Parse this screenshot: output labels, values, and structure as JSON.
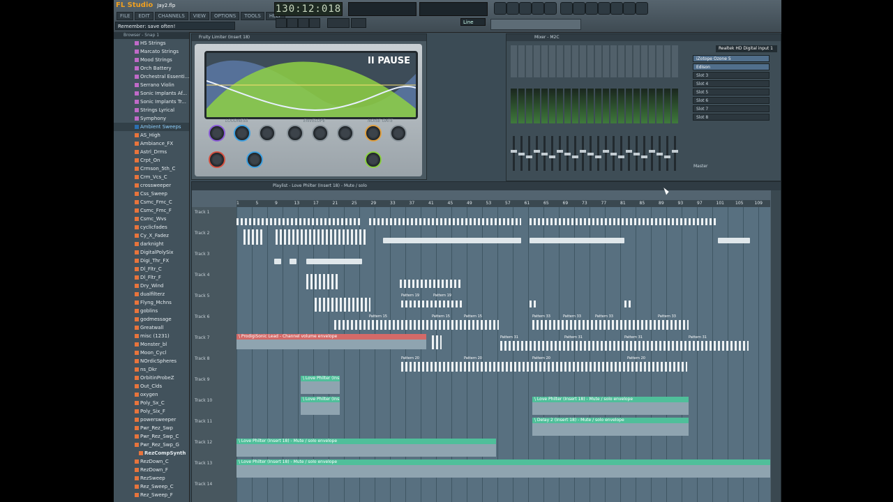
{
  "app": {
    "name": "FL Studio",
    "project": "Jay2.flp",
    "menu": [
      "FILE",
      "EDIT",
      "CHANNELS",
      "VIEW",
      "OPTIONS",
      "TOOLS",
      "HELP"
    ],
    "hint": "Remember: save often!",
    "time": "130:12:018",
    "tempo_label": "Line"
  },
  "browser": {
    "title": "Browser - Snap 1",
    "items": [
      {
        "label": "HS Strings",
        "color": "#c06ac8"
      },
      {
        "label": "Marcato Strings",
        "color": "#c06ac8"
      },
      {
        "label": "Mood Strings",
        "color": "#c06ac8"
      },
      {
        "label": "Orch Battery",
        "color": "#c06ac8"
      },
      {
        "label": "Orchestral Essenti...",
        "color": "#c06ac8"
      },
      {
        "label": "Serrano Violin",
        "color": "#c06ac8"
      },
      {
        "label": "Sonic Implants Af...",
        "color": "#c06ac8"
      },
      {
        "label": "Sonic Implants Tr...",
        "color": "#c06ac8"
      },
      {
        "label": "Strings Lyrical",
        "color": "#c06ac8"
      },
      {
        "label": "Symphony",
        "color": "#c06ac8"
      },
      {
        "label": "Ambient Sweeps",
        "color": "#2b6fb0",
        "selected": true
      },
      {
        "label": "AS_High",
        "color": "#e8743c"
      },
      {
        "label": "Ambiance_FX",
        "color": "#e8743c"
      },
      {
        "label": "Astrl_Drms",
        "color": "#e8743c"
      },
      {
        "label": "Crpt_On",
        "color": "#e8743c"
      },
      {
        "label": "Crmson_5th_C",
        "color": "#e8743c"
      },
      {
        "label": "Crm_Vcs_C",
        "color": "#e8743c"
      },
      {
        "label": "crossweeper",
        "color": "#e8743c"
      },
      {
        "label": "Css_Sweep",
        "color": "#e8743c"
      },
      {
        "label": "Csmc_Fmc_C",
        "color": "#e8743c"
      },
      {
        "label": "Csmc_Fmc_F",
        "color": "#e8743c"
      },
      {
        "label": "Csmc_Wvs",
        "color": "#e8743c"
      },
      {
        "label": "cyclicfades",
        "color": "#e8743c"
      },
      {
        "label": "Cy_X_Fadez",
        "color": "#e8743c"
      },
      {
        "label": "darknight",
        "color": "#e8743c"
      },
      {
        "label": "DigitalPolySix",
        "color": "#e8743c"
      },
      {
        "label": "Digi_Thr_FX",
        "color": "#e8743c"
      },
      {
        "label": "Dl_Fltr_C",
        "color": "#e8743c"
      },
      {
        "label": "Dl_Fltr_F",
        "color": "#e8743c"
      },
      {
        "label": "Dry_Wind",
        "color": "#e8743c"
      },
      {
        "label": "dualfilterz",
        "color": "#e8743c"
      },
      {
        "label": "Flyng_Mchns",
        "color": "#e8743c"
      },
      {
        "label": "goblins",
        "color": "#e8743c"
      },
      {
        "label": "godmessage",
        "color": "#e8743c"
      },
      {
        "label": "Greatwall",
        "color": "#e8743c"
      },
      {
        "label": "misc (1231)",
        "color": "#e8743c"
      },
      {
        "label": "Monster_bl",
        "color": "#e8743c"
      },
      {
        "label": "Moon_Cycl",
        "color": "#e8743c"
      },
      {
        "label": "NOrdicSpheres",
        "color": "#e8743c"
      },
      {
        "label": "ns_Dkr",
        "color": "#e8743c"
      },
      {
        "label": "OrbitinProbeZ",
        "color": "#e8743c"
      },
      {
        "label": "Out_Clds",
        "color": "#e8743c"
      },
      {
        "label": "oxygen",
        "color": "#e8743c"
      },
      {
        "label": "Poly_Sx_C",
        "color": "#e8743c"
      },
      {
        "label": "Poly_Six_F",
        "color": "#e8743c"
      },
      {
        "label": "powersweeper",
        "color": "#e8743c"
      },
      {
        "label": "Pwr_Rez_Swp",
        "color": "#e8743c"
      },
      {
        "label": "Pwr_Rez_Swp_C",
        "color": "#e8743c"
      },
      {
        "label": "Pwr_Rez_Swp_G",
        "color": "#e8743c"
      },
      {
        "label": "RezCompSynth",
        "color": "#e8743c",
        "sub": true
      },
      {
        "label": "RezDown_C",
        "color": "#e8743c"
      },
      {
        "label": "RezDown_F",
        "color": "#e8743c"
      },
      {
        "label": "RezSweep",
        "color": "#e8743c"
      },
      {
        "label": "Rez_Sweep_C",
        "color": "#e8743c"
      },
      {
        "label": "Rez_Sweep_F",
        "color": "#e8743c"
      }
    ]
  },
  "limiter": {
    "title": "Fruity Limiter (Insert 18)",
    "state": "II PAUSE",
    "sections": [
      "LOUDNESS",
      "ENVELOPE",
      "NOISE GATE"
    ]
  },
  "mixer": {
    "title": "Mixer - M2C",
    "input": "Realtek HD Digital input 1",
    "slots": [
      "iZotope Ozone 5",
      "Edison",
      "Slot 3",
      "Slot 4",
      "Slot 5",
      "Slot 6",
      "Slot 7",
      "Slot 8"
    ],
    "out_label": "Master"
  },
  "playlist": {
    "title": "Playlist - Love Philter (Insert 18) - Mute / solo",
    "ruler": [
      "1",
      "5",
      "9",
      "13",
      "17",
      "21",
      "25",
      "29",
      "33",
      "37",
      "41",
      "45",
      "49",
      "53",
      "57",
      "61",
      "65",
      "69",
      "73",
      "77",
      "81",
      "85",
      "89",
      "93",
      "97",
      "101",
      "105",
      "109"
    ],
    "tracks": [
      "Track 1",
      "Track 2",
      "Track 3",
      "Track 4",
      "Track 5",
      "Track 6",
      "Track 7",
      "Track 8",
      "Track 9",
      "Track 10",
      "Track 11",
      "Track 12",
      "Track 13",
      "Track 14"
    ],
    "clips": {
      "red_env": "\\ ProdigiSonic Lead - Channel volume envelope",
      "love_a": "\\ Love Philter (Ins...",
      "love_b": "\\ Love Philter (Ins...",
      "love_mute": "\\ Love Philter (Insert 18) - Mute / solo envelope",
      "delay": "\\ Delay 2 (Insert 18) - Mute / solo envelope",
      "love_12": "\\ Love Philter (Insert 18) - Mute / solo envelope",
      "love_13": "\\ Love Philter (Insert 18) - Mute / solo envelope",
      "p15": "Pattern 15",
      "p19": "Pattern 19",
      "p20": "Pattern 20",
      "p31": "Pattern 31",
      "p33": "Pattern 33"
    }
  }
}
